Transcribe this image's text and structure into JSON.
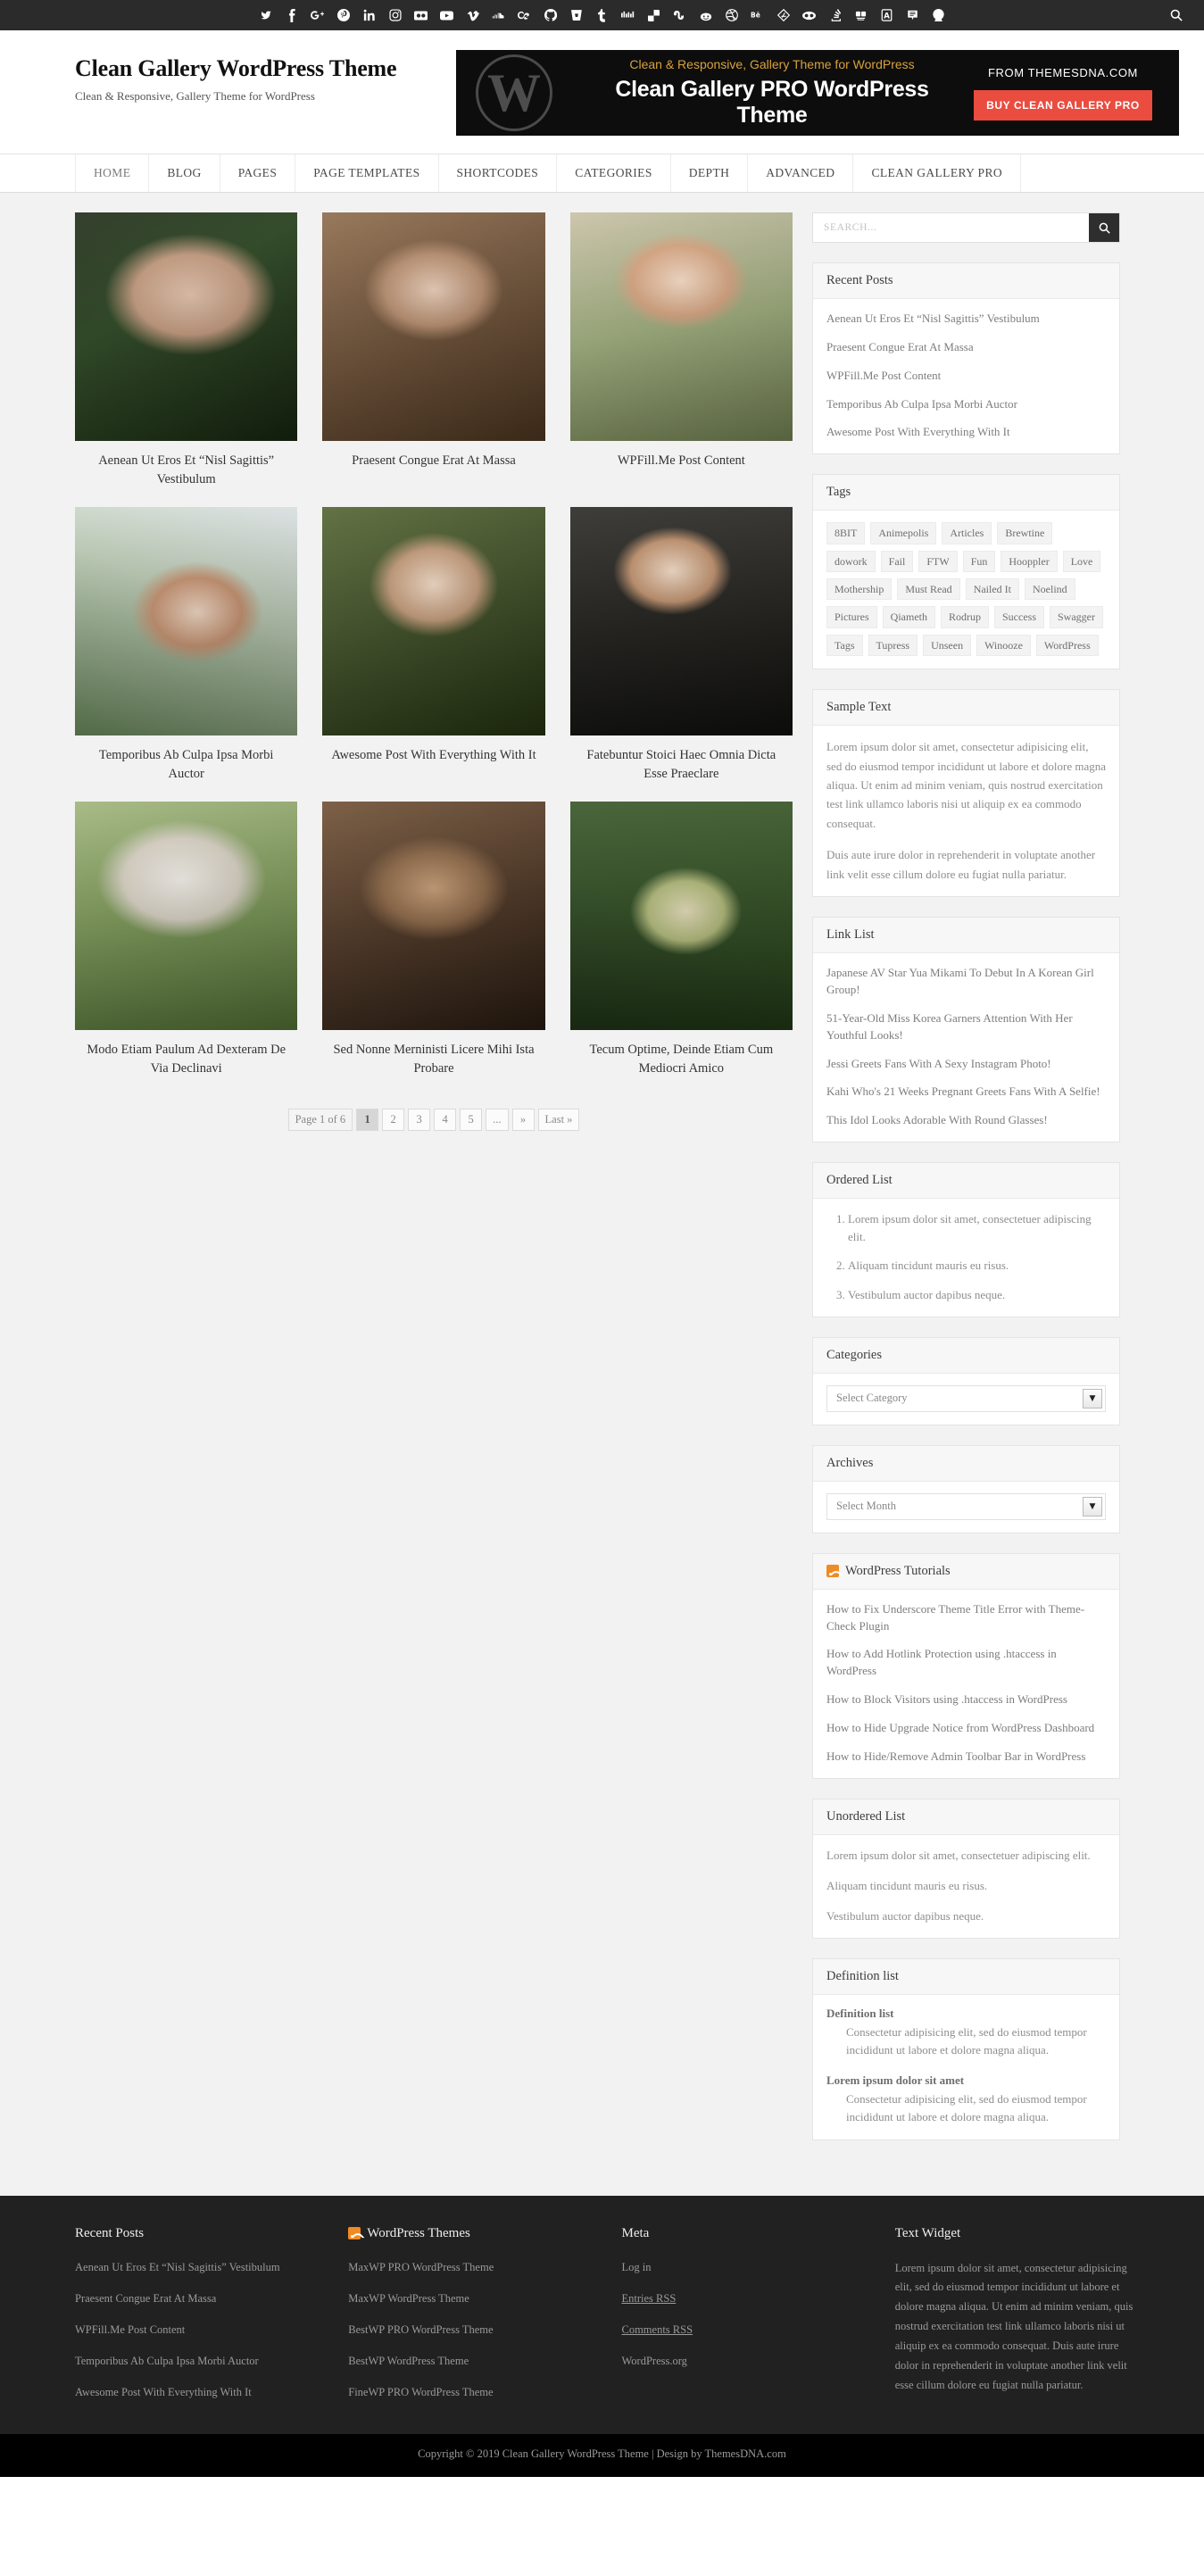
{
  "topbar": {
    "social_icons": [
      "twitter-icon",
      "facebook-icon",
      "google-plus-icon",
      "pinterest-icon",
      "linkedin-icon",
      "instagram-icon",
      "flickr-icon",
      "youtube-icon",
      "vimeo-icon",
      "soundcloud-icon",
      "lastfm-icon",
      "github-icon",
      "bitbucket-icon",
      "tumblr-icon",
      "digg-icon",
      "delicious-icon",
      "stumbleupon-icon",
      "reddit-icon",
      "dribbble-icon",
      "behance-icon",
      "deviantart-icon",
      "ello-icon",
      "stackoverflow-icon",
      "slideshare-icon",
      "apple-icon",
      "spotify-icon",
      "envato-icon"
    ],
    "search_icon": "search-icon"
  },
  "header": {
    "site_title": "Clean Gallery WordPress Theme",
    "site_description": "Clean & Responsive, Gallery Theme for WordPress",
    "banner": {
      "logo": "wordpress-logo",
      "tagline": "Clean & Responsive, Gallery Theme for WordPress",
      "title": "Clean Gallery PRO WordPress Theme",
      "from": "FROM THEMESDNA.COM",
      "button": "BUY CLEAN GALLERY PRO",
      "accent": "#ea4c40",
      "tagline_color": "#d9a13b"
    }
  },
  "nav": {
    "items": [
      {
        "label": "HOME",
        "active": true
      },
      {
        "label": "BLOG",
        "active": false
      },
      {
        "label": "PAGES",
        "active": false
      },
      {
        "label": "PAGE TEMPLATES",
        "active": false
      },
      {
        "label": "SHORTCODES",
        "active": false
      },
      {
        "label": "CATEGORIES",
        "active": false
      },
      {
        "label": "DEPTH",
        "active": false
      },
      {
        "label": "ADVANCED",
        "active": false
      },
      {
        "label": "CLEAN GALLERY PRO",
        "active": false
      }
    ]
  },
  "gallery": {
    "posts": [
      {
        "title": "Aenean Ut Eros Et “Nisl Sagittis” Vestibulum"
      },
      {
        "title": "Praesent Congue Erat At Massa"
      },
      {
        "title": "WPFill.Me Post Content"
      },
      {
        "title": "Temporibus Ab Culpa Ipsa Morbi Auctor"
      },
      {
        "title": "Awesome Post With Everything With It"
      },
      {
        "title": "Fatebuntur Stoici Haec Omnia Dicta Esse Praeclare"
      },
      {
        "title": "Modo Etiam Paulum Ad Dexteram De Via Declinavi"
      },
      {
        "title": "Sed Nonne Merninisti Licere Mihi Ista Probare"
      },
      {
        "title": "Tecum Optime, Deinde Etiam Cum Mediocri Amico"
      }
    ]
  },
  "pagination": {
    "info": "Page 1 of 6",
    "pages": [
      "1",
      "2",
      "3",
      "4",
      "5",
      "...",
      "»",
      "Last »"
    ],
    "current": "1"
  },
  "sidebar": {
    "search": {
      "placeholder": "SEARCH...",
      "value": "",
      "icon": "search-icon"
    },
    "recent_posts": {
      "title": "Recent Posts",
      "items": [
        "Aenean Ut Eros Et “Nisl Sagittis” Vestibulum",
        "Praesent Congue Erat At Massa",
        "WPFill.Me Post Content",
        "Temporibus Ab Culpa Ipsa Morbi Auctor",
        "Awesome Post With Everything With It"
      ]
    },
    "tags": {
      "title": "Tags",
      "items": [
        "8BIT",
        "Animepolis",
        "Articles",
        "Brewtine",
        "dowork",
        "Fail",
        "FTW",
        "Fun",
        "Hooppler",
        "Love",
        "Mothership",
        "Must Read",
        "Nailed It",
        "Noelind",
        "Pictures",
        "Qiameth",
        "Rodrup",
        "Success",
        "Swagger",
        "Tags",
        "Tupress",
        "Unseen",
        "Winooze",
        "WordPress"
      ]
    },
    "sample_text": {
      "title": "Sample Text",
      "paragraphs": [
        "Lorem ipsum dolor sit amet, consectetur adipisicing elit, sed do eiusmod tempor incididunt ut labore et dolore magna aliqua. Ut enim ad minim veniam, quis nostrud exercitation test link ullamco laboris nisi ut aliquip ex ea commodo consequat.",
        "Duis aute irure dolor in reprehenderit in voluptate another link velit esse cillum dolore eu fugiat nulla pariatur."
      ]
    },
    "link_list": {
      "title": "Link List",
      "items": [
        "Japanese AV Star Yua Mikami To Debut In A Korean Girl Group!",
        "51-Year-Old Miss Korea Garners Attention With Her Youthful Looks!",
        "Jessi Greets Fans With A Sexy Instagram Photo!",
        "Kahi Who's 21 Weeks Pregnant Greets Fans With A Selfie!",
        "This Idol Looks Adorable With Round Glasses!"
      ]
    },
    "ordered_list": {
      "title": "Ordered List",
      "items": [
        "Lorem ipsum dolor sit amet, consectetuer adipiscing elit.",
        "Aliquam tincidunt mauris eu risus.",
        "Vestibulum auctor dapibus neque."
      ]
    },
    "categories": {
      "title": "Categories",
      "selected": "Select Category",
      "icon": "chevron-down-icon"
    },
    "archives": {
      "title": "Archives",
      "selected": "Select Month",
      "icon": "chevron-down-icon"
    },
    "tutorials": {
      "title": "WordPress Tutorials",
      "icon": "rss-icon",
      "items": [
        "How to Fix Underscore Theme Title Error with Theme-Check Plugin",
        "How to Add Hotlink Protection using .htaccess in WordPress",
        "How to Block Visitors using .htaccess in WordPress",
        "How to Hide Upgrade Notice from WordPress Dashboard",
        "How to Hide/Remove Admin Toolbar Bar in WordPress"
      ]
    },
    "unordered_list": {
      "title": "Unordered List",
      "items": [
        "Lorem ipsum dolor sit amet, consectetuer adipiscing elit.",
        "Aliquam tincidunt mauris eu risus.",
        "Vestibulum auctor dapibus neque."
      ]
    },
    "definition_list": {
      "title": "Definition list",
      "entries": [
        {
          "term": "Definition list",
          "desc": "Consectetur adipisicing elit, sed do eiusmod tempor incididunt ut labore et dolore magna aliqua."
        },
        {
          "term": "Lorem ipsum dolor sit amet",
          "desc": "Consectetur adipisicing elit, sed do eiusmod tempor incididunt ut labore et dolore magna aliqua."
        }
      ]
    }
  },
  "footer": {
    "columns": [
      {
        "title": "Recent Posts",
        "icon": null,
        "links": [
          "Aenean Ut Eros Et “Nisl Sagittis” Vestibulum",
          "Praesent Congue Erat At Massa",
          "WPFill.Me Post Content",
          "Temporibus Ab Culpa Ipsa Morbi Auctor",
          "Awesome Post With Everything With It"
        ]
      },
      {
        "title": "WordPress Themes",
        "icon": "rss-icon",
        "links": [
          "MaxWP PRO WordPress Theme",
          "MaxWP WordPress Theme",
          "BestWP PRO WordPress Theme",
          "BestWP WordPress Theme",
          "FineWP PRO WordPress Theme"
        ]
      },
      {
        "title": "Meta",
        "icon": null,
        "links": [
          "Log in",
          "Entries RSS",
          "Comments RSS",
          "WordPress.org"
        ]
      }
    ],
    "text_widget": {
      "title": "Text Widget",
      "body": "Lorem ipsum dolor sit amet, consectetur adipisicing elit, sed do eiusmod tempor incididunt ut labore et dolore magna aliqua. Ut enim ad minim veniam, quis nostrud exercitation test link ullamco laboris nisi ut aliquip ex ea commodo consequat. Duis aute irure dolor in reprehenderit in voluptate another link velit esse cillum dolore eu fugiat nulla pariatur."
    },
    "copyright": "Copyright © 2019 Clean Gallery WordPress Theme | Design by ThemesDNA.com"
  }
}
